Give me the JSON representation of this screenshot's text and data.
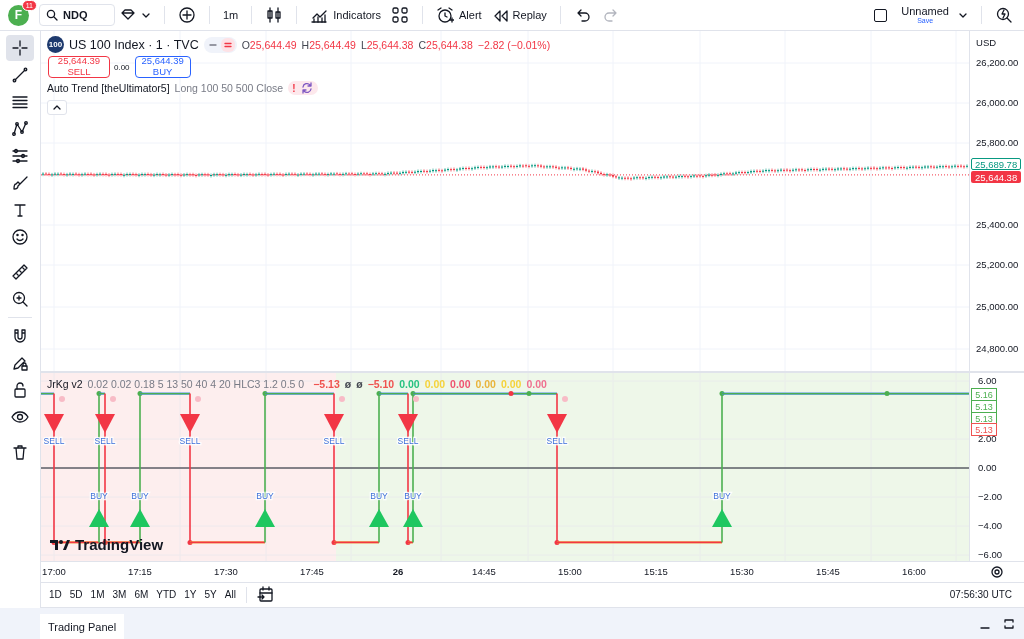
{
  "topbar": {
    "avatar": "F",
    "notifications": "11",
    "symbol": "NDQ",
    "interval": "1m",
    "indicators": "Indicators",
    "alert": "Alert",
    "replay": "Replay",
    "layout_name": "Unnamed",
    "save": "Save",
    "checkbox_checked": false
  },
  "drawing_tools": [
    {
      "kind": "crosshair",
      "selected": true
    },
    {
      "kind": "line",
      "selected": false
    },
    {
      "kind": "lines",
      "selected": false
    },
    {
      "kind": "zigzag",
      "selected": false
    },
    {
      "kind": "sliders",
      "selected": false
    },
    {
      "kind": "brush",
      "selected": false
    },
    {
      "kind": "text",
      "selected": false
    },
    {
      "kind": "smiley",
      "selected": false
    },
    {
      "kind": "ruler",
      "selected": false
    },
    {
      "kind": "zoom",
      "selected": false
    },
    {
      "kind": "magnet",
      "selected": false
    },
    {
      "kind": "pencil-lock",
      "selected": false
    },
    {
      "kind": "lock",
      "selected": false
    },
    {
      "kind": "eye",
      "selected": false
    },
    {
      "kind": "trash",
      "selected": false
    }
  ],
  "price_pane": {
    "symbol_badge": "100",
    "title": "US 100 Index · 1 · TVC",
    "ohlc": [
      {
        "label": "O",
        "value": "25,644.49"
      },
      {
        "label": "H",
        "value": "25,644.49"
      },
      {
        "label": "L",
        "value": "25,644.38"
      },
      {
        "label": "C",
        "value": "25,644.38"
      }
    ],
    "change": "−2.82 (−0.01%)",
    "sell": {
      "price": "25,644.39",
      "label": "SELL"
    },
    "spread": "0.00",
    "buy": {
      "price": "25,644.39",
      "label": "BUY"
    },
    "indicator": {
      "name": "Auto Trend [theUltimator5]",
      "params": "Long 100 50 500 Close",
      "warning": "!"
    },
    "currency": "USD",
    "price_ticks": [
      "26,200.00",
      "26,000.00",
      "25,800.00",
      "25,400.00",
      "25,200.00",
      "25,000.00",
      "24,800.00"
    ],
    "price_labels": [
      {
        "kind": "outline",
        "text": "25,689.78"
      },
      {
        "kind": "solid",
        "text": "25,644.38"
      }
    ]
  },
  "indicator_pane": {
    "name": "JrKg v2",
    "params": "0.02 0.02 0.18 5 13 50 40 4 20 HLC3 1.2 0.5 0",
    "values": [
      {
        "text": "−5.13",
        "color": "#ef5350"
      },
      {
        "text": "ø",
        "color": "#434651"
      },
      {
        "text": "ø",
        "color": "#434651"
      },
      {
        "text": "−5.10",
        "color": "#ef5350"
      },
      {
        "text": "0.00",
        "color": "#26c281"
      },
      {
        "text": "0.00",
        "color": "#f5d33b"
      },
      {
        "text": "0.00",
        "color": "#ef5370"
      },
      {
        "text": "0.00",
        "color": "#e9b43c"
      },
      {
        "text": "0.00",
        "color": "#f5d33b"
      },
      {
        "text": "0.00",
        "color": "#ef7090"
      }
    ],
    "ticks": [
      "6.00",
      "2.00",
      "0.00",
      "−2.00",
      "−4.00",
      "−6.00"
    ],
    "value_labels": [
      {
        "text": "5.16",
        "color": "#4caf50"
      },
      {
        "text": "5.13",
        "color": "#4caf50"
      },
      {
        "text": "5.13",
        "color": "#4caf50"
      },
      {
        "text": "5.13",
        "color": "#ef5350"
      }
    ],
    "signals": [
      {
        "kind": "sell",
        "label": "SELL"
      },
      {
        "kind": "sell",
        "label": "SELL"
      },
      {
        "kind": "sell",
        "label": "SELL"
      },
      {
        "kind": "sell",
        "label": "SELL"
      },
      {
        "kind": "sell",
        "label": "SELL"
      },
      {
        "kind": "sell",
        "label": "SELL"
      },
      {
        "kind": "buy",
        "label": "BUY"
      },
      {
        "kind": "buy",
        "label": "BUY"
      },
      {
        "kind": "buy",
        "label": "BUY"
      },
      {
        "kind": "buy",
        "label": "BUY"
      },
      {
        "kind": "buy",
        "label": "BUY"
      },
      {
        "kind": "buy",
        "label": "BUY"
      }
    ],
    "logo": "TradingView"
  },
  "time_axis": [
    {
      "text": "17:00",
      "kind": "time"
    },
    {
      "text": "17:15",
      "kind": "time"
    },
    {
      "text": "17:30",
      "kind": "time"
    },
    {
      "text": "17:45",
      "kind": "time"
    },
    {
      "text": "26",
      "kind": "day"
    },
    {
      "text": "14:45",
      "kind": "time"
    },
    {
      "text": "15:00",
      "kind": "time"
    },
    {
      "text": "15:15",
      "kind": "time"
    },
    {
      "text": "15:30",
      "kind": "time"
    },
    {
      "text": "15:45",
      "kind": "time"
    },
    {
      "text": "16:00",
      "kind": "time"
    }
  ],
  "ranges": [
    "1D",
    "5D",
    "1M",
    "3M",
    "6M",
    "YTD",
    "1Y",
    "5Y",
    "All"
  ],
  "clock": "07:56:30 UTC",
  "trading_panel": "Trading Panel"
}
